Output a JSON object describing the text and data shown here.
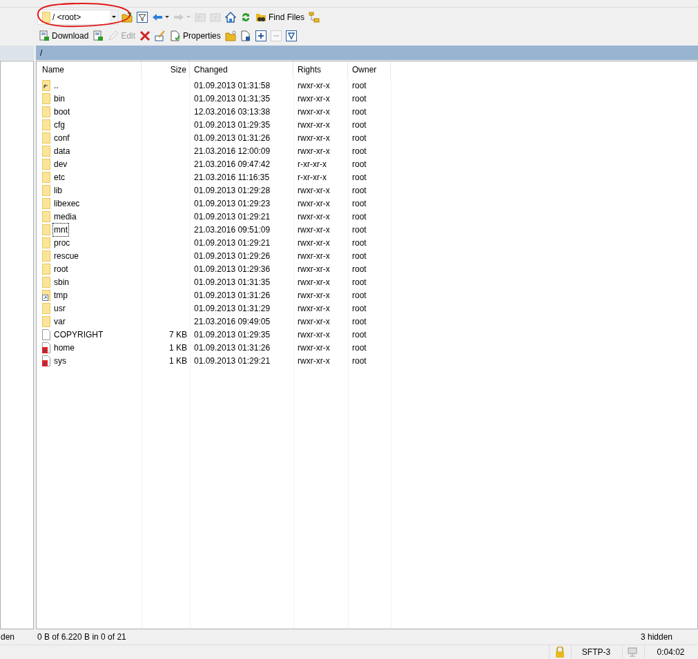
{
  "toolbar_top": [
    {
      "kind": "path",
      "label": "/ <root>",
      "disabled": false
    },
    {
      "kind": "open-folder",
      "disabled": false
    },
    {
      "kind": "filter",
      "disabled": false
    },
    {
      "kind": "back",
      "disabled": false
    },
    {
      "kind": "forward",
      "disabled": true
    },
    {
      "kind": "parent",
      "disabled": true
    },
    {
      "kind": "root",
      "disabled": true
    },
    {
      "kind": "home",
      "disabled": false
    },
    {
      "kind": "refresh",
      "disabled": false
    },
    {
      "kind": "find",
      "label": "Find Files",
      "disabled": false
    },
    {
      "kind": "tree",
      "disabled": false
    }
  ],
  "toolbar_bottom": [
    {
      "kind": "download",
      "label": "Download",
      "disabled": false
    },
    {
      "kind": "download-alt",
      "disabled": false
    },
    {
      "kind": "edit",
      "label": "Edit",
      "disabled": true
    },
    {
      "kind": "delete",
      "disabled": false
    },
    {
      "kind": "rename",
      "disabled": false
    },
    {
      "kind": "properties",
      "label": "Properties",
      "disabled": false
    },
    {
      "kind": "new-folder",
      "disabled": false
    },
    {
      "kind": "new-file",
      "disabled": false
    },
    {
      "kind": "expand",
      "disabled": false
    },
    {
      "kind": "collapse",
      "disabled": true
    },
    {
      "kind": "select",
      "disabled": false
    }
  ],
  "path_bar": "/",
  "table": {
    "columns": [
      "Name",
      "Size",
      "Changed",
      "Rights",
      "Owner"
    ],
    "rows": [
      {
        "kind": "parent",
        "name": "..",
        "size": "",
        "changed": "01.09.2013 01:31:58",
        "rights": "rwxr-xr-x",
        "owner": "root",
        "focused": false
      },
      {
        "kind": "folder",
        "name": "bin",
        "size": "",
        "changed": "01.09.2013 01:31:35",
        "rights": "rwxr-xr-x",
        "owner": "root",
        "focused": false
      },
      {
        "kind": "folder",
        "name": "boot",
        "size": "",
        "changed": "12.03.2016 03:13:38",
        "rights": "rwxr-xr-x",
        "owner": "root",
        "focused": false
      },
      {
        "kind": "folder",
        "name": "cfg",
        "size": "",
        "changed": "01.09.2013 01:29:35",
        "rights": "rwxr-xr-x",
        "owner": "root",
        "focused": false
      },
      {
        "kind": "folder",
        "name": "conf",
        "size": "",
        "changed": "01.09.2013 01:31:26",
        "rights": "rwxr-xr-x",
        "owner": "root",
        "focused": false
      },
      {
        "kind": "folder",
        "name": "data",
        "size": "",
        "changed": "21.03.2016 12:00:09",
        "rights": "rwxr-xr-x",
        "owner": "root",
        "focused": false
      },
      {
        "kind": "folder",
        "name": "dev",
        "size": "",
        "changed": "21.03.2016 09:47:42",
        "rights": "r-xr-xr-x",
        "owner": "root",
        "focused": false
      },
      {
        "kind": "folder",
        "name": "etc",
        "size": "",
        "changed": "21.03.2016 11:16:35",
        "rights": "r-xr-xr-x",
        "owner": "root",
        "focused": false
      },
      {
        "kind": "folder",
        "name": "lib",
        "size": "",
        "changed": "01.09.2013 01:29:28",
        "rights": "rwxr-xr-x",
        "owner": "root",
        "focused": false
      },
      {
        "kind": "folder",
        "name": "libexec",
        "size": "",
        "changed": "01.09.2013 01:29:23",
        "rights": "rwxr-xr-x",
        "owner": "root",
        "focused": false
      },
      {
        "kind": "folder",
        "name": "media",
        "size": "",
        "changed": "01.09.2013 01:29:21",
        "rights": "rwxr-xr-x",
        "owner": "root",
        "focused": false
      },
      {
        "kind": "folder",
        "name": "mnt",
        "size": "",
        "changed": "21.03.2016 09:51:09",
        "rights": "rwxr-xr-x",
        "owner": "root",
        "focused": true
      },
      {
        "kind": "folder",
        "name": "proc",
        "size": "",
        "changed": "01.09.2013 01:29:21",
        "rights": "rwxr-xr-x",
        "owner": "root",
        "focused": false
      },
      {
        "kind": "folder",
        "name": "rescue",
        "size": "",
        "changed": "01.09.2013 01:29:26",
        "rights": "rwxr-xr-x",
        "owner": "root",
        "focused": false
      },
      {
        "kind": "folder",
        "name": "root",
        "size": "",
        "changed": "01.09.2013 01:29:36",
        "rights": "rwxr-xr-x",
        "owner": "root",
        "focused": false
      },
      {
        "kind": "folder",
        "name": "sbin",
        "size": "",
        "changed": "01.09.2013 01:31:35",
        "rights": "rwxr-xr-x",
        "owner": "root",
        "focused": false
      },
      {
        "kind": "link-folder",
        "name": "tmp",
        "size": "",
        "changed": "01.09.2013 01:31:26",
        "rights": "rwxr-xr-x",
        "owner": "root",
        "focused": false
      },
      {
        "kind": "folder",
        "name": "usr",
        "size": "",
        "changed": "01.09.2013 01:31:29",
        "rights": "rwxr-xr-x",
        "owner": "root",
        "focused": false
      },
      {
        "kind": "folder",
        "name": "var",
        "size": "",
        "changed": "21.03.2016 09:49:05",
        "rights": "rwxr-xr-x",
        "owner": "root",
        "focused": false
      },
      {
        "kind": "file",
        "name": "COPYRIGHT",
        "size": "7 KB",
        "changed": "01.09.2013 01:29:35",
        "rights": "rwxr-xr-x",
        "owner": "root",
        "focused": false
      },
      {
        "kind": "link-file",
        "name": "home",
        "size": "1 KB",
        "changed": "01.09.2013 01:31:26",
        "rights": "rwxr-xr-x",
        "owner": "root",
        "focused": false
      },
      {
        "kind": "link-file",
        "name": "sys",
        "size": "1 KB",
        "changed": "01.09.2013 01:29:21",
        "rights": "rwxr-xr-x",
        "owner": "root",
        "focused": false
      }
    ]
  },
  "status_left": "den",
  "status_selection": "0 B of 6.220 B in 0 of 21",
  "status_hidden": "3 hidden",
  "bottom_bar": {
    "protocol": "SFTP-3",
    "elapsed": "0:04:02"
  }
}
